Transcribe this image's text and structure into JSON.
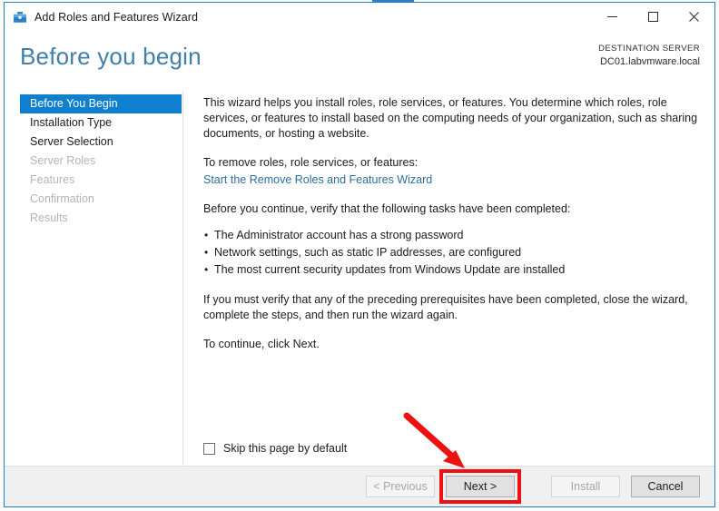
{
  "window": {
    "title": "Add Roles and Features Wizard",
    "icon": "toolbox-icon",
    "minimize_label": "—",
    "maximize_label": "□",
    "close_label": "✕",
    "border_color": "#2a7fc9"
  },
  "header": {
    "page_title": "Before you begin",
    "destination_server_label": "DESTINATION SERVER",
    "destination_server_value": "DC01.labvmware.local",
    "title_color": "#3f7fa8"
  },
  "nav": {
    "items": [
      {
        "label": "Before You Begin",
        "state": "selected"
      },
      {
        "label": "Installation Type",
        "state": "enabled"
      },
      {
        "label": "Server Selection",
        "state": "enabled"
      },
      {
        "label": "Server Roles",
        "state": "disabled"
      },
      {
        "label": "Features",
        "state": "disabled"
      },
      {
        "label": "Confirmation",
        "state": "disabled"
      },
      {
        "label": "Results",
        "state": "disabled"
      }
    ],
    "selected_bg": "#0f7fcf",
    "disabled_color": "#b4b4b4"
  },
  "content": {
    "intro_paragraph": "This wizard helps you install roles, role services, or features. You determine which roles, role services, or features to install based on the computing needs of your organization, such as sharing documents, or hosting a website.",
    "remove_intro": "To remove roles, role services, or features:",
    "remove_link": "Start the Remove Roles and Features Wizard",
    "remove_link_color": "#2a6e9e",
    "verify_intro": "Before you continue, verify that the following tasks have been completed:",
    "prerequisites": [
      "The Administrator account has a strong password",
      "Network settings, such as static IP addresses, are configured",
      "The most current security updates from Windows Update are installed"
    ],
    "verify_note": "If you must verify that any of the preceding prerequisites have been completed, close the wizard, complete the steps, and then run the wizard again.",
    "continue_note": "To continue, click Next.",
    "skip_checkbox_label": "Skip this page by default",
    "skip_checkbox_checked": false
  },
  "footer": {
    "buttons": [
      {
        "label": "< Previous",
        "state": "disabled",
        "highlighted": false
      },
      {
        "label": "Next >",
        "state": "enabled",
        "highlighted": true
      },
      {
        "label": "Install",
        "state": "disabled",
        "highlighted": false
      },
      {
        "label": "Cancel",
        "state": "enabled",
        "highlighted": false
      }
    ]
  },
  "annotation": {
    "arrow_color": "#ee1111",
    "highlight_color": "#ee1111",
    "target": "Next >"
  }
}
